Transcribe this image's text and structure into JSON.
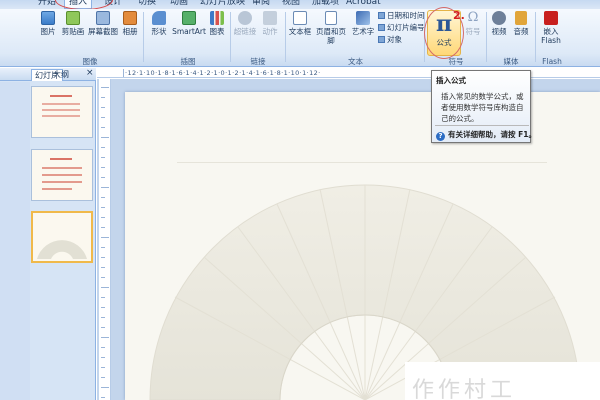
{
  "tabs": [
    "开始",
    "插入",
    "设计",
    "切换",
    "动画",
    "幻灯片放映",
    "审阅",
    "视图",
    "加载项",
    "Acrobat"
  ],
  "ribbon": {
    "picture": "图片",
    "clipart": "剪贴画",
    "screenshot": "屏幕截图",
    "album": "相册",
    "shapes": "形状",
    "smartart": "SmartArt",
    "chart": "图表",
    "hyperlink": "超链接",
    "action": "动作",
    "textbox": "文本框",
    "header_footer": "页眉和页脚",
    "wordart": "艺术字",
    "datetime": "日期和时间",
    "slide_number": "幻灯片编号",
    "object": "对象",
    "formula": "公式",
    "symbol": "符号",
    "video": "视频",
    "audio": "音频",
    "insert_flash": "嵌入 Flash",
    "groups": {
      "image": "图像",
      "illustrations": "插图",
      "links": "链接",
      "text": "文本",
      "symbols": "符号",
      "media": "媒体",
      "flash": "Flash"
    }
  },
  "step_number": "2.",
  "tooltip": {
    "title": "插入公式",
    "description": "插入常见的数学公式，或者使用数学符号库构造自己的公式。",
    "help": "有关详细帮助，请按 F1。"
  },
  "left_panel": {
    "tabs": [
      "幻灯片",
      "大纲"
    ],
    "close": "×"
  },
  "ruler_text": "·12·1·10·1·8·1·6·1·4·1·2·1·0·1·2·1·4·1·6·1·8·1·10·1·12·",
  "watermark": "作作村工"
}
